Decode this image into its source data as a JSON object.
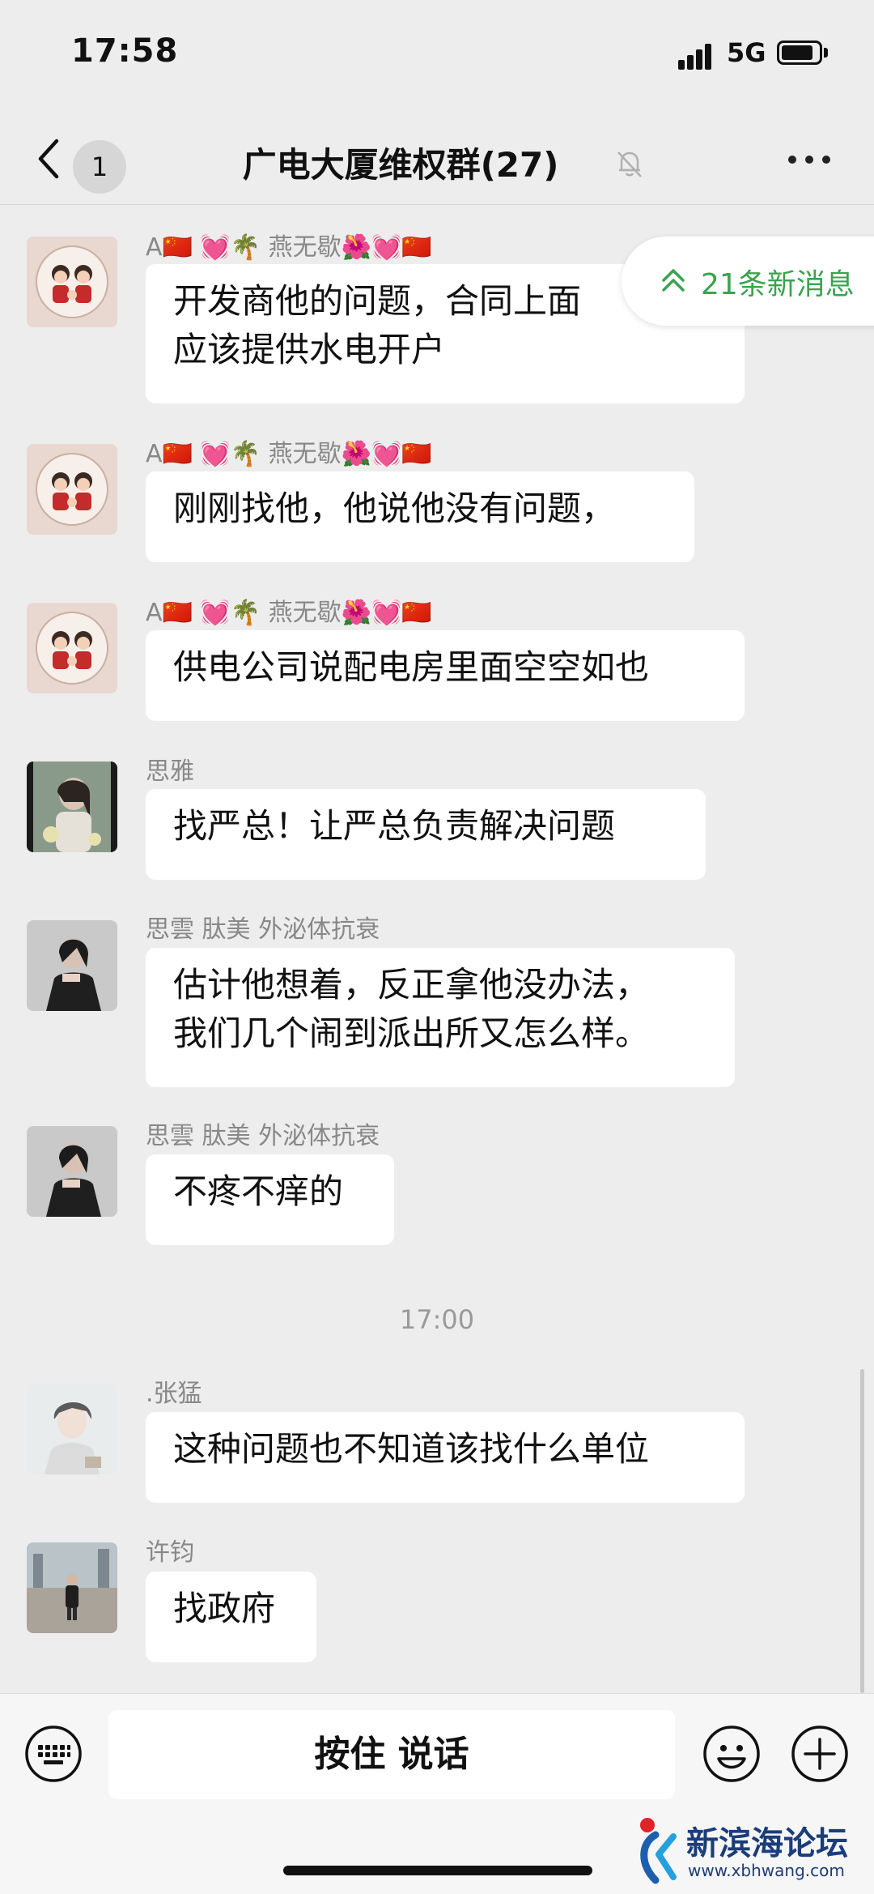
{
  "status_bar": {
    "time": "17:58",
    "network": "5G"
  },
  "nav": {
    "unread_count": "1",
    "title": "广电大厦维权群(27)"
  },
  "new_messages_pill": {
    "label": "21条新消息"
  },
  "messages": [
    {
      "sender": "A🇨🇳 💓🌴 燕无歇🌺💓🇨🇳",
      "lines": [
        "开发商他的问题，合同上面",
        "应该提供水电开户"
      ]
    },
    {
      "sender": "A🇨🇳 💓🌴 燕无歇🌺💓🇨🇳",
      "lines": [
        "刚刚找他，他说他没有问题，"
      ]
    },
    {
      "sender": "A🇨🇳 💓🌴 燕无歇🌺💓🇨🇳",
      "lines": [
        "供电公司说配电房里面空空如也"
      ]
    },
    {
      "sender": "思雅",
      "lines": [
        "找严总！让严总负责解决问题"
      ]
    },
    {
      "sender": "思雲  肽美 外泌体抗衰",
      "lines": [
        "估计他想着，反正拿他没办法，",
        "我们几个闹到派出所又怎么样。"
      ]
    },
    {
      "sender": "思雲  肽美 外泌体抗衰",
      "lines": [
        "不疼不痒的"
      ]
    },
    {
      "sender": ".张猛",
      "lines": [
        "这种问题也不知道该找什么单位"
      ]
    },
    {
      "sender": "许钧",
      "lines": [
        "找政府"
      ]
    }
  ],
  "time_divider": "17:00",
  "input_bar": {
    "talk_label": "按住 说话"
  },
  "watermark": {
    "title": "新滨海论坛",
    "url": "www.xbhwang.com"
  },
  "colors": {
    "background": "#ededed",
    "bubble": "#ffffff",
    "accent_green": "#3aa34f"
  }
}
